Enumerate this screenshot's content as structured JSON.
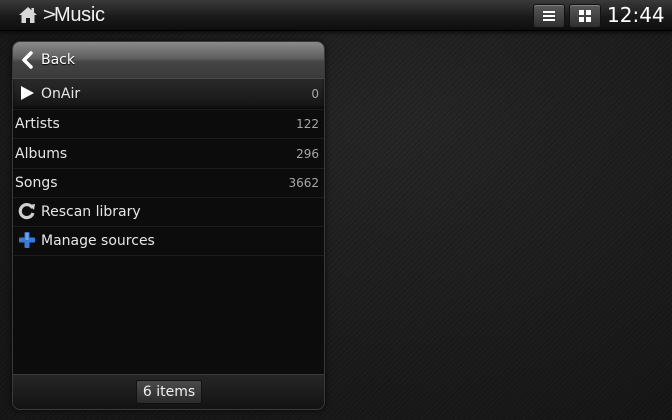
{
  "header": {
    "breadcrumb_separator": ">",
    "title": "Music",
    "list_view_icon": "list-view-icon",
    "grid_view_icon": "grid-view-icon",
    "clock": "12:44"
  },
  "panel": {
    "back_label": "Back",
    "items": [
      {
        "label": "OnAir",
        "count": "0",
        "icon": "play-icon"
      },
      {
        "label": "Artists",
        "count": "122"
      },
      {
        "label": "Albums",
        "count": "296"
      },
      {
        "label": "Songs",
        "count": "3662"
      },
      {
        "label": "Rescan library",
        "icon": "refresh-icon"
      },
      {
        "label": "Manage sources",
        "icon": "plus-icon"
      }
    ],
    "footer_text": "6 items"
  },
  "colors": {
    "background": "#1c1c1c",
    "text": "#e6e6e6",
    "count_text": "#a6a6a6",
    "accent_blue": "#3a7ad8"
  }
}
